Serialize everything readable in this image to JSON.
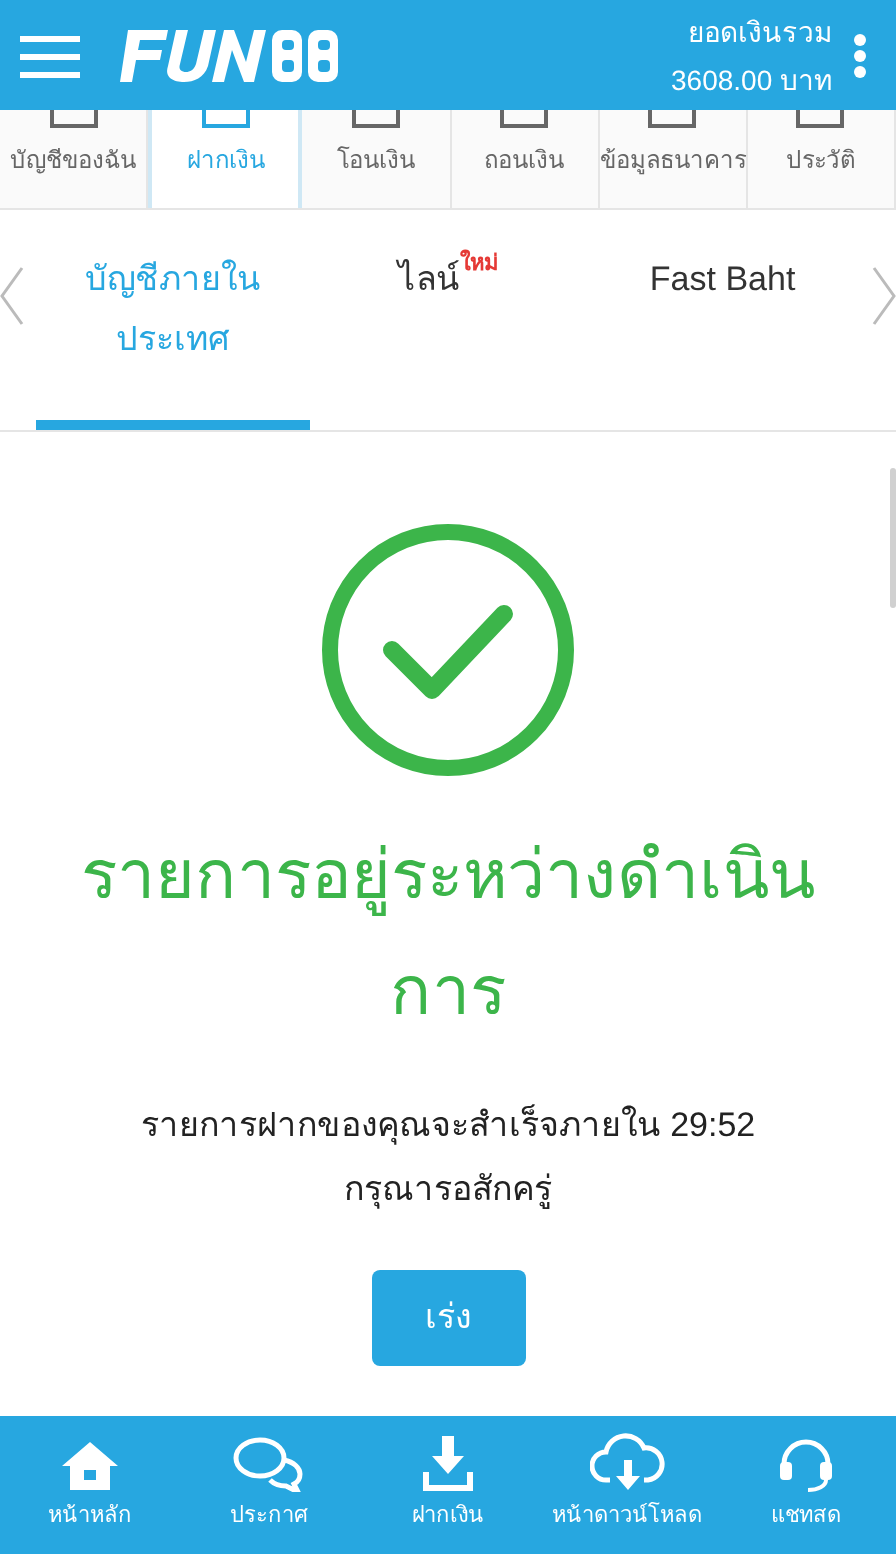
{
  "header": {
    "balance_label": "ยอดเงินรวม",
    "balance": "3608.00 บาท"
  },
  "menu_tabs": [
    {
      "label": "บัญชีของฉัน",
      "selected": false
    },
    {
      "label": "ฝากเงิน",
      "selected": true
    },
    {
      "label": "โอนเงิน",
      "selected": false
    },
    {
      "label": "ถอนเงิน",
      "selected": false
    },
    {
      "label": "ข้อมูลธนาคาร",
      "selected": false
    },
    {
      "label": "ประวัติ",
      "selected": false
    }
  ],
  "method_tabs": [
    {
      "label": "บัญชีภายในประเทศ",
      "selected": true
    },
    {
      "label": "ไลน์",
      "badge": "ใหม่",
      "selected": false
    },
    {
      "label": "Fast Baht",
      "selected": false
    }
  ],
  "status": {
    "title": "รายการอยู่ระหว่างดำเนินการ",
    "message": "รายการฝากของคุณจะสำเร็จภายใน 29:52",
    "note": "กรุณารอสักครู่",
    "button": "เร่ง"
  },
  "bottom_nav": [
    {
      "label": "หน้าหลัก"
    },
    {
      "label": "ประกาศ"
    },
    {
      "label": "ฝากเงิน"
    },
    {
      "label": "หน้าดาวน์โหลด"
    },
    {
      "label": "แชทสด"
    }
  ]
}
